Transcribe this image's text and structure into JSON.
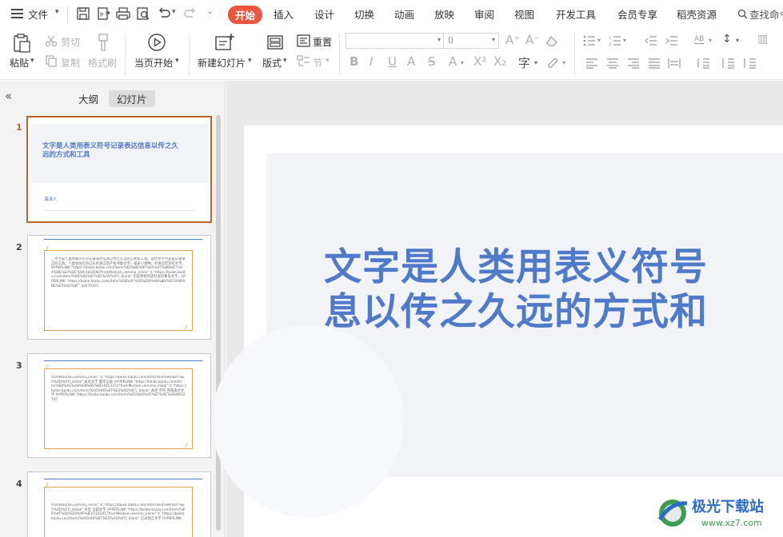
{
  "menu": {
    "file_label": "文件",
    "tabs": [
      "开始",
      "插入",
      "设计",
      "切换",
      "动画",
      "放映",
      "审阅",
      "视图",
      "开发工具",
      "会员专享",
      "稻壳资源"
    ],
    "search_label": "查找命令"
  },
  "ribbon": {
    "paste": "粘贴",
    "cut": "剪切",
    "copy": "复制",
    "format_painter": "格式刷",
    "play_from_current": "当页开始",
    "new_slide": "新建幻灯片",
    "layout": "版式",
    "reset": "重置",
    "section": "节",
    "font_size_value": "0"
  },
  "panel": {
    "collapse_glyph": "«",
    "tabs": [
      "大纲",
      "幻灯片"
    ],
    "selected_tab": "幻灯片"
  },
  "slides": [
    {
      "number": "1",
      "title_text": "文字是人类用表义符号记录表达信息以传之久远的方式和工具",
      "subtitle": "演讲人"
    },
    {
      "number": "2",
      "body_text": "。文字是人类用表义符号记录表达信息以传之久远的方式和工具。现代文字大多是记录语言的工具。人类往往先有口头的语言后产生书面文字，很多小语种，有语言但没有文字。HYPERLINK \"https://baike.baidu.com/item/%E5%8E%9F%E5%A7%8B%E7%A4%BE%E4%BC%9A/1616087fromModule=lemma_inlink\" \\t \"https://baike.baidu.com/item/%E6%96%87%E5%AD%97/_blank\" 历史原始氏族社会的象形文字。HYPERLINK \"https://baike.baidu.com/item/%E8%AF%AD%E8%A8%80/%E5%9B%BE%E5%83%8F\" 42674321"
    },
    {
      "number": "3",
      "body_text": "fromModule=lemma_inlink\" \\t \"https://baike.baidu.com/item/%E6%96%87%E5%AD%97/_blank\" 表达文字 最早记录 HYPERLINK \"https://baike.baidu.com/item/%E8%A1%A8%E8%BE%BE/4053372?fromModule=lemma_inlink\" \\t \"https://baike.baidu.com/item/%E6%96%87%E5%AD%97/_blank\" 表述 字符 用来表达文字 HYPERLINK \"https://baike.baidu.com/item/%E5%AD%97%E7%AC%A6/8932747"
    },
    {
      "number": "4",
      "body_text": "fromModule=lemma_inlink\" \\t \"https://baike.baidu.com/item/%E6%96%87%E5%AD%97/_blank\" 声音 远超文字 HYPERLINK \"https://baike.baidu.com/item/%E8%AF%AD%E9%9F%B3/1142457fromModule=lemma_inlink\" \\t \"https://baike.baidu.com/item/%E6%96%87%E5%AD%97/_blank\" 记录语言文字 HYPERLINK"
    }
  ],
  "main_slide": {
    "title_line1": "文字是人类用表义符号",
    "title_line2": "息以传之久远的方式和"
  },
  "watermark": {
    "brand": "极光下载站",
    "url": "www.xz7.com"
  },
  "colors": {
    "accent": "#e8563f",
    "selection": "#c0622b",
    "title_blue": "#4f79c9",
    "frame_orange": "#e6a24a"
  }
}
